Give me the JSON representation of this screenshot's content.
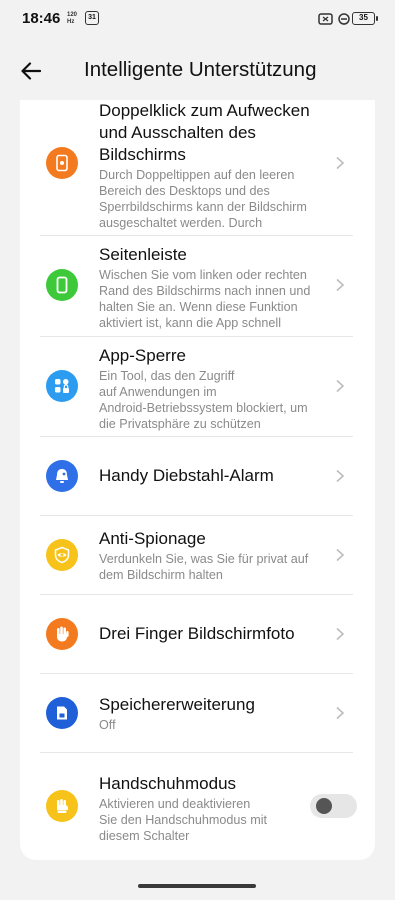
{
  "status_bar": {
    "time": "18:46",
    "refresh_rate": "120",
    "refresh_unit": "Hz",
    "calendar_day": "31",
    "battery": "35"
  },
  "header": {
    "title": "Intelligente Unterstützung"
  },
  "items": [
    {
      "title_line1": "Doppelklick zum Aufwecken",
      "title_line2": "und Ausschalten des",
      "title_line3": "Bildschirms",
      "sub_line1": "Durch Doppeltippen auf den leeren",
      "sub_line2": "Bereich des Desktops und des",
      "sub_line3": "Sperrbildschirms kann der Bildschirm",
      "sub_line4": "ausgeschaltet werden. Durch",
      "icon": "double-tap-icon",
      "color": "#f47a1f"
    },
    {
      "title": "Seitenleiste",
      "sub_line1": "Wischen Sie vom linken oder rechten",
      "sub_line2": "Rand des Bildschirms nach innen und",
      "sub_line3": "halten Sie an. Wenn diese Funktion",
      "sub_line4": "aktiviert ist, kann die App schnell",
      "icon": "sidebar-phone-icon",
      "color": "#3ec93a"
    },
    {
      "title": "App-Sperre",
      "sub_line1": "Ein Tool, das den Zugriff",
      "sub_line2": "auf Anwendungen im",
      "sub_line3": "Android-Betriebssystem blockiert, um",
      "sub_line4": "die Privatsphäre zu schützen",
      "icon": "app-lock-icon",
      "color": "#2b9cf0"
    },
    {
      "title": "Handy Diebstahl-Alarm",
      "icon": "alarm-icon",
      "color": "#2f6fe8"
    },
    {
      "title": "Anti-Spionage",
      "sub_line1": "Verdunkeln Sie, was Sie für privat auf",
      "sub_line2": "dem Bildschirm halten",
      "icon": "eye-shield-icon",
      "color": "#f7c21a"
    },
    {
      "title": "Drei Finger Bildschirmfoto",
      "icon": "hand-icon",
      "color": "#f47a1f"
    },
    {
      "title": "Speichererweiterung",
      "sub_line1": "Off",
      "icon": "memory-icon",
      "color": "#1f5fd8"
    },
    {
      "title": "Handschuhmodus",
      "sub_line1": "Aktivieren und deaktivieren",
      "sub_line2": "Sie den Handschuhmodus mit",
      "sub_line3": "diesem Schalter",
      "icon": "glove-icon",
      "color": "#f7c21a",
      "toggle": "off"
    }
  ]
}
